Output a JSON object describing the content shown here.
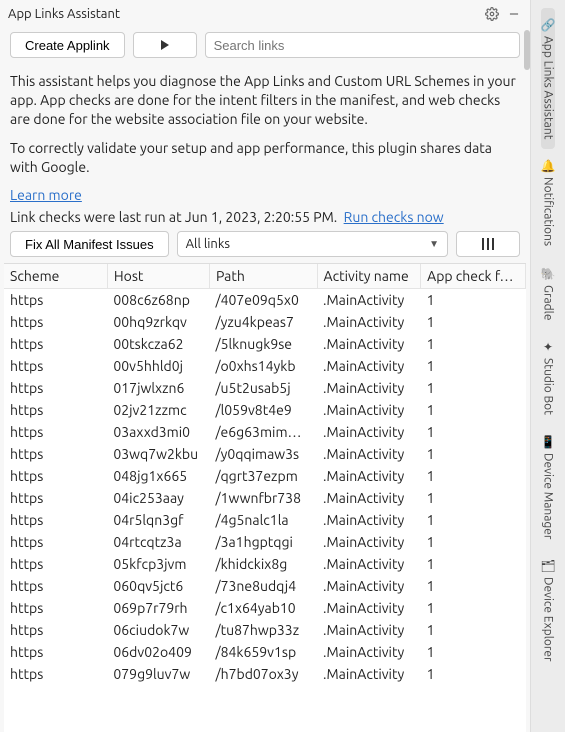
{
  "titlebar": {
    "title": "App Links Assistant"
  },
  "toolbar": {
    "create_label": "Create Applink",
    "search_placeholder": "Search links"
  },
  "description": {
    "p1": "This assistant helps you diagnose the App Links and Custom URL Schemes in your app. App checks are done for the intent filters in the manifest, and web checks are done for the website association file on your website.",
    "p2": "To correctly validate your setup and app performance, this plugin shares data with Google.",
    "learn_more": "Learn more"
  },
  "status": {
    "last_run_prefix": "Link checks were last run at ",
    "last_run_time": "Jun 1, 2023, 2:20:55 PM.",
    "run_now": "Run checks now"
  },
  "controls": {
    "fix_label": "Fix All Manifest Issues",
    "filter_value": "All links"
  },
  "table": {
    "headers": {
      "scheme": "Scheme",
      "host": "Host",
      "path": "Path",
      "activity": "Activity name",
      "appcheck": "App check f…"
    },
    "rows": [
      {
        "scheme": "https",
        "host": "008c6z68np",
        "path": "/407e09q5x0",
        "activity": ".MainActivity",
        "appcheck": "1"
      },
      {
        "scheme": "https",
        "host": "00hq9zrkqv",
        "path": "/yzu4kpeas7",
        "activity": ".MainActivity",
        "appcheck": "1"
      },
      {
        "scheme": "https",
        "host": "00tskcza62",
        "path": "/5lknugk9se",
        "activity": ".MainActivity",
        "appcheck": "1"
      },
      {
        "scheme": "https",
        "host": "00v5hhld0j",
        "path": "/o0xhs14ykb",
        "activity": ".MainActivity",
        "appcheck": "1"
      },
      {
        "scheme": "https",
        "host": "017jwlxzn6",
        "path": "/u5t2usab5j",
        "activity": ".MainActivity",
        "appcheck": "1"
      },
      {
        "scheme": "https",
        "host": "02jv21zzmc",
        "path": "/l059v8t4e9",
        "activity": ".MainActivity",
        "appcheck": "1"
      },
      {
        "scheme": "https",
        "host": "03axxd3mi0",
        "path": "/e6g63mim…",
        "activity": ".MainActivity",
        "appcheck": "1"
      },
      {
        "scheme": "https",
        "host": "03wq7w2kbu",
        "path": "/y0qqimaw3s",
        "activity": ".MainActivity",
        "appcheck": "1"
      },
      {
        "scheme": "https",
        "host": "048jg1x665",
        "path": "/qgrt37ezpm",
        "activity": ".MainActivity",
        "appcheck": "1"
      },
      {
        "scheme": "https",
        "host": "04ic253aay",
        "path": "/1wwnfbr738",
        "activity": ".MainActivity",
        "appcheck": "1"
      },
      {
        "scheme": "https",
        "host": "04r5lqn3gf",
        "path": "/4g5nalc1la",
        "activity": ".MainActivity",
        "appcheck": "1"
      },
      {
        "scheme": "https",
        "host": "04rtcqtz3a",
        "path": "/3a1hgptqgi",
        "activity": ".MainActivity",
        "appcheck": "1"
      },
      {
        "scheme": "https",
        "host": "05kfcp3jvm",
        "path": "/khidckix8g",
        "activity": ".MainActivity",
        "appcheck": "1"
      },
      {
        "scheme": "https",
        "host": "060qv5jct6",
        "path": "/73ne8udqj4",
        "activity": ".MainActivity",
        "appcheck": "1"
      },
      {
        "scheme": "https",
        "host": "069p7r79rh",
        "path": "/c1x64yab10",
        "activity": ".MainActivity",
        "appcheck": "1"
      },
      {
        "scheme": "https",
        "host": "06ciudok7w",
        "path": "/tu87hwp33z",
        "activity": ".MainActivity",
        "appcheck": "1"
      },
      {
        "scheme": "https",
        "host": "06dv02o409",
        "path": "/84k659v1sp",
        "activity": ".MainActivity",
        "appcheck": "1"
      },
      {
        "scheme": "https",
        "host": "079g9luv7w",
        "path": "/h7bd07ox3y",
        "activity": ".MainActivity",
        "appcheck": "1"
      }
    ]
  },
  "rail": {
    "items": [
      {
        "label": "App Links Assistant",
        "icon": "🔗",
        "active": true
      },
      {
        "label": "Notifications",
        "icon": "🔔",
        "active": false
      },
      {
        "label": "Gradle",
        "icon": "🐘",
        "active": false
      },
      {
        "label": "Studio Bot",
        "icon": "✦",
        "active": false
      },
      {
        "label": "Device Manager",
        "icon": "📱",
        "active": false
      },
      {
        "label": "Device Explorer",
        "icon": "🗂",
        "active": false
      }
    ]
  }
}
